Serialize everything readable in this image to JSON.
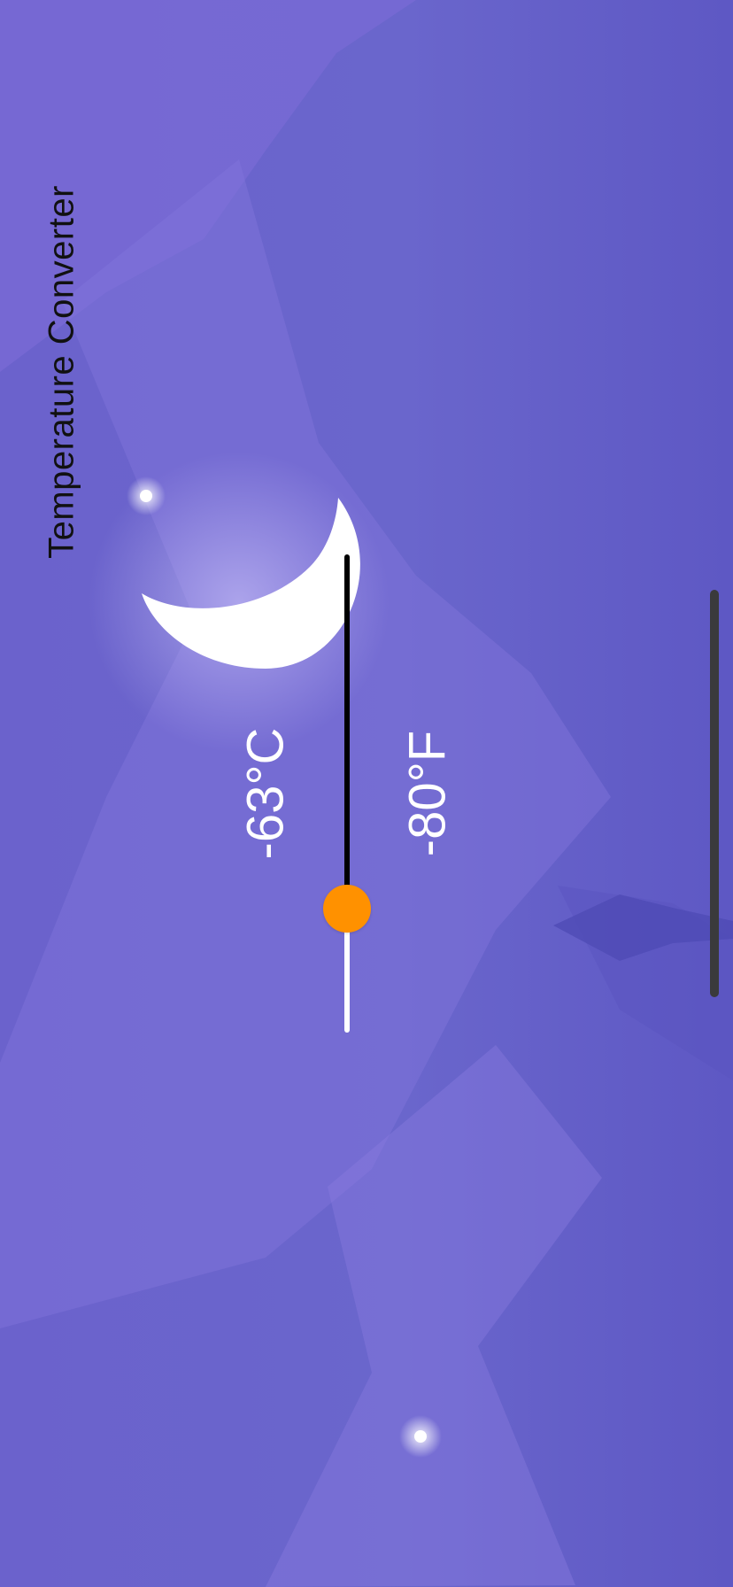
{
  "app": {
    "title": "Temperature Converter"
  },
  "temperature": {
    "celsius_label": "-63°C",
    "fahrenheit_label": "-80°F"
  },
  "slider": {
    "value_fraction": 0.74
  },
  "colors": {
    "background": "#6a66cc",
    "slider_thumb": "#ff9100",
    "slider_active_track": "#000000",
    "slider_inactive_track": "#ffffff",
    "text": "#ffffff"
  },
  "icons": {
    "moon": "moon-icon",
    "stars": "star-icon"
  }
}
